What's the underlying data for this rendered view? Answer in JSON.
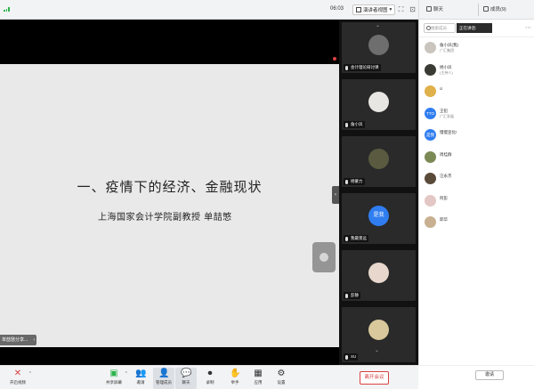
{
  "topbar": {
    "timer": "06:03",
    "view_label": "演讲者视图",
    "icons": [
      "signal-icon",
      "view-icon",
      "fullscreen-icon",
      "minimize-icon"
    ]
  },
  "share": {
    "slide_title": "一、疫情下的经济、金融现状",
    "slide_subtitle": "上海国家会计学院副教授  单喆慜",
    "sharer_label": "单喆慜分享...",
    "sharer_chevron": "‹"
  },
  "gallery": {
    "tiles": [
      {
        "name": "会计理论研讨课",
        "avatar_color": "#6e6e6e"
      },
      {
        "name": "詹小凤",
        "avatar_color": "#e8e6e2"
      },
      {
        "name": "杨蒙力",
        "avatar_color": "#5a5a40"
      },
      {
        "name": "我最景远",
        "avatar_color": "#2f7df0",
        "avatar_text": "是我"
      },
      {
        "name": "彭静",
        "avatar_color": "#e7d7cc"
      },
      {
        "name": "XU",
        "avatar_color": "#d9c89b"
      }
    ],
    "toggle_arrow": "‹",
    "scroll_chevron": "⌄"
  },
  "panel": {
    "tab_participants": "聊天",
    "tab_members": "成员(9)",
    "search_placeholder": "搜索成员",
    "speaking_label": "正在讲话:",
    "more_icon": "⋯",
    "participants": [
      {
        "name": "詹小凤(我)",
        "sub": "广汇集团",
        "color": "#c9c4bd",
        "bar": true
      },
      {
        "name": "杨小凤",
        "sub": "(主持人)",
        "color": "#3b3b35",
        "bar": true
      },
      {
        "name": "ci",
        "sub": "",
        "color": "#e0b04a"
      },
      {
        "name": "王铅",
        "sub": "广汇发展",
        "color": "#2f7df0",
        "text": "TTO"
      },
      {
        "name": "慢慢宣化!",
        "sub": "",
        "color": "#2f7df0",
        "text": "是我"
      },
      {
        "name": "周桂群",
        "sub": "",
        "color": "#7b8a55"
      },
      {
        "name": "汪永杰",
        "sub": "",
        "color": "#5a4a3a"
      },
      {
        "name": "阿彭",
        "sub": "",
        "color": "#e3c7c4"
      },
      {
        "name": "邱华",
        "sub": "",
        "color": "#c8b090"
      }
    ],
    "invite_label": "邀请"
  },
  "toolbar": {
    "buttons": [
      {
        "id": "audio",
        "label": "开启视频",
        "icon": "🎥",
        "icon_name": "video-off-icon"
      },
      {
        "id": "share",
        "label": "共享屏幕",
        "icon": "⬆",
        "icon_name": "share-screen-icon"
      },
      {
        "id": "invite",
        "label": "邀请",
        "icon": "👥",
        "icon_name": "invite-icon"
      },
      {
        "id": "members",
        "label": "管理成员",
        "icon": "👤",
        "icon_name": "members-icon"
      },
      {
        "id": "chat",
        "label": "聊天",
        "icon": "💬",
        "icon_name": "chat-icon"
      },
      {
        "id": "record",
        "label": "录制",
        "icon": "⏺",
        "icon_name": "record-icon"
      },
      {
        "id": "raise",
        "label": "举手",
        "icon": "✋",
        "icon_name": "raise-hand-icon"
      },
      {
        "id": "apps",
        "label": "应用",
        "icon": "▦",
        "icon_name": "apps-icon"
      },
      {
        "id": "settings",
        "label": "设置",
        "icon": "⚙",
        "icon_name": "settings-icon"
      }
    ],
    "leave_label": "离开会议"
  }
}
